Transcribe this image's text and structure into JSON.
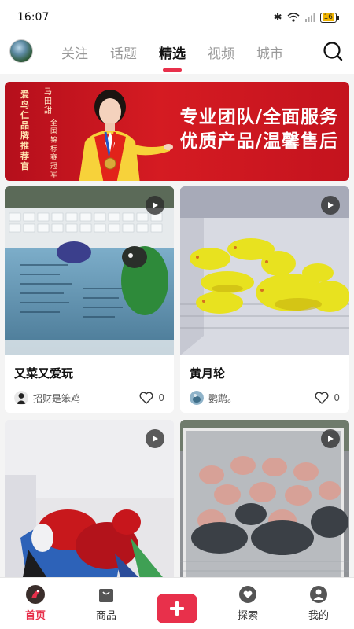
{
  "status_bar": {
    "time": "16:07",
    "battery": "16"
  },
  "header": {
    "tabs": [
      {
        "label": "关注"
      },
      {
        "label": "话题"
      },
      {
        "label": "精选"
      },
      {
        "label": "视频"
      },
      {
        "label": "城市"
      }
    ],
    "active_tab": "精选"
  },
  "banner": {
    "brand_text": "爱鸟仁品牌推荐官",
    "name": "马田甜",
    "name_title": "全国锦标赛冠军",
    "slogan_line1": "专业团队/全面服务",
    "slogan_line2": "优质产品/温馨售后"
  },
  "posts": [
    {
      "title": "又菜又爱玩",
      "author": "招财是笨鸡",
      "likes": "0"
    },
    {
      "title": "黄月轮",
      "author": "鹦鹉。",
      "likes": "0"
    },
    {
      "title": "",
      "author": "",
      "likes": ""
    },
    {
      "title": "",
      "author": "",
      "likes": ""
    }
  ],
  "bottom_nav": {
    "home": "首页",
    "goods": "商品",
    "explore": "探索",
    "mine": "我的"
  },
  "colors": {
    "accent": "#e8304b",
    "banner_red": "#c4131e"
  }
}
